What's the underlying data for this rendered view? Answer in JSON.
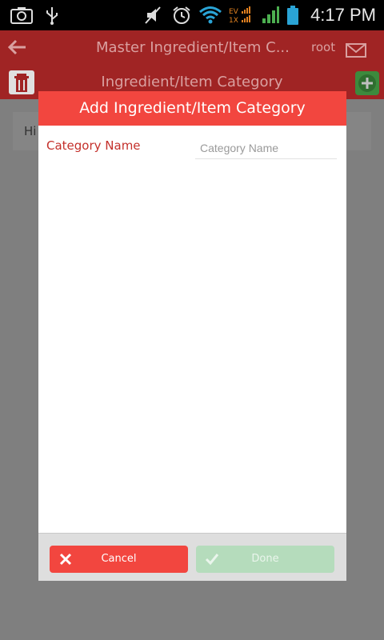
{
  "status_bar": {
    "time": "4:17 PM",
    "icons": [
      "camera-icon",
      "usb-icon",
      "mute-icon",
      "alarm-icon",
      "wifi-icon",
      "evdo-signal-icon",
      "cell-signal-icon",
      "battery-icon"
    ]
  },
  "app_bar": {
    "title": "Master Ingredient/Item C...",
    "user": "root",
    "subtitle": "Ingredient/Item Category",
    "icons": [
      "back-arrow-icon",
      "mail-icon",
      "trash-icon",
      "add-icon"
    ]
  },
  "list": {
    "first_item": "Hi"
  },
  "dialog": {
    "title": "Add Ingredient/Item Category",
    "field_label": "Category Name",
    "field_placeholder": "Category Name",
    "field_value": "",
    "cancel_label": "Cancel",
    "done_label": "Done"
  },
  "colors": {
    "dialog_header": "#f2463f",
    "cancel_button": "#f2463f",
    "done_button_disabled": "#b5dcbc",
    "label_red": "#c4302b",
    "overlay": "#7f7f7f"
  }
}
